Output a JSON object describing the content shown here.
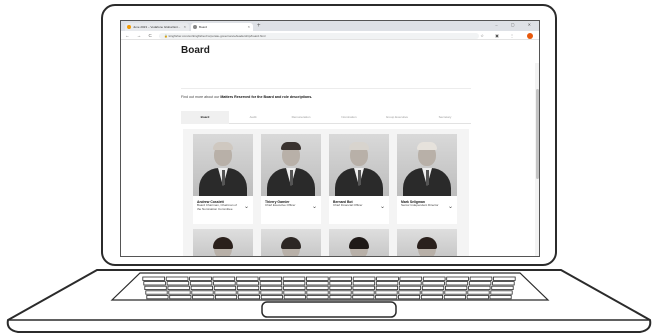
{
  "browser": {
    "tabs": [
      {
        "label": "June 2023 – Vodafone Global Ent..."
      },
      {
        "label": "Board"
      }
    ],
    "new_tab": "+",
    "window_controls": "– ▢ ✕",
    "nav": "← → C ⌂",
    "url": "🔒 kingfisher.com/en/kingfisher/corporate-governance/leadership/board.html",
    "toolbar_icons": "☆ ▣ ⋮"
  },
  "page": {
    "title": "Board",
    "intro_prefix": "Find out more about our ",
    "intro_bold": "Matters Reserved for the Board and role descriptions.",
    "tabs": [
      "Board",
      "Audit",
      "Remuneration",
      "Nomination",
      "Group Executive",
      "Secretary"
    ],
    "active_tab": 0
  },
  "directors": [
    {
      "name": "Andrew Cosslett",
      "role": "Board Chairman, Chairman of the Nomination Committee",
      "hair_color": "#cfc8c0"
    },
    {
      "name": "Thierry Garnier",
      "role": "Chief Executive Officer",
      "hair_color": "#3a3330"
    },
    {
      "name": "Bernard Bot",
      "role": "Chief Financial Officer",
      "hair_color": "#d8d4ce"
    },
    {
      "name": "Mark Seligman",
      "role": "Senior Independent Director",
      "hair_color": "#e6e2dc"
    }
  ],
  "second_row": [
    {
      "hair_color": "#2a201b"
    },
    {
      "hair_color": "#2d2724"
    },
    {
      "hair_color": "#1f1a18"
    },
    {
      "hair_color": "#2a211d"
    }
  ],
  "icons": {
    "chevron": "⌄",
    "close": "×"
  }
}
